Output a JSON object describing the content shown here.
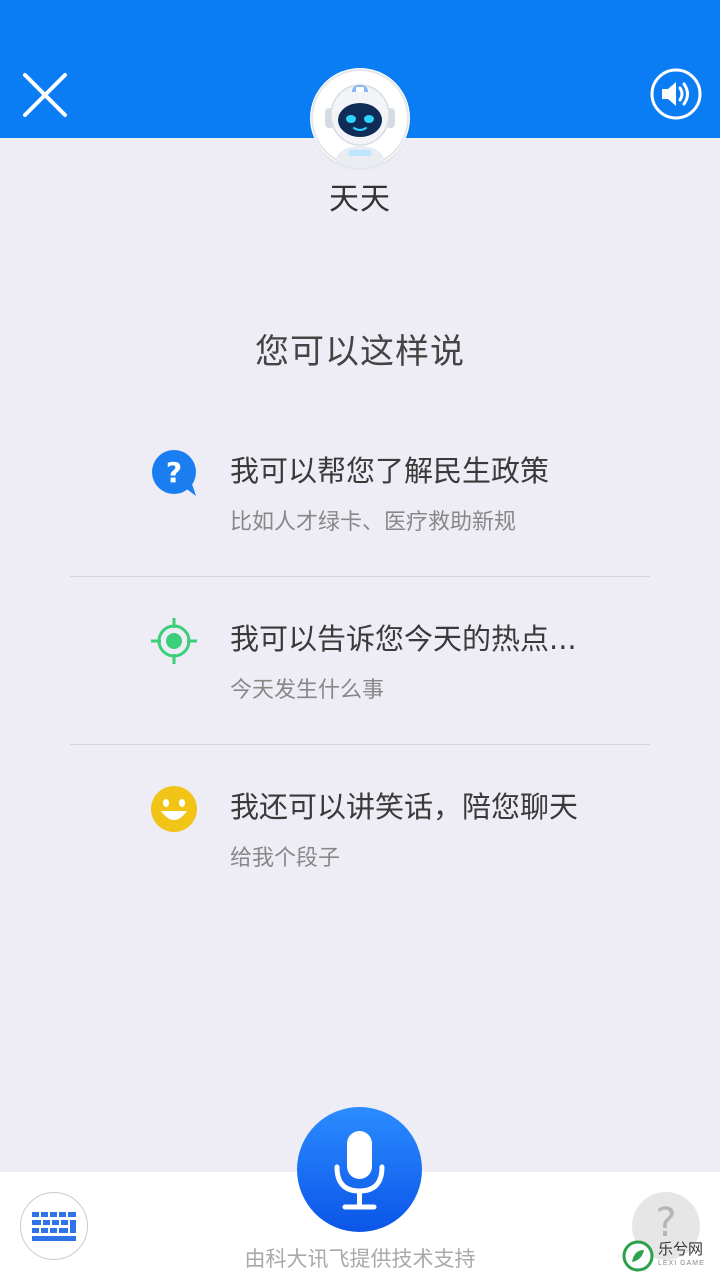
{
  "header": {
    "bot_name": "天天",
    "accent_color": "#0a7df5",
    "close_icon": "close-icon",
    "sound_icon": "speaker-icon",
    "avatar_icon": "robot-avatar-icon"
  },
  "main": {
    "prompt_title": "您可以这样说",
    "suggestions": [
      {
        "icon": "question-bubble-icon",
        "icon_color": "#1a7ef0",
        "title": "我可以帮您了解民生政策",
        "example": "比如人才绿卡、医疗救助新规"
      },
      {
        "icon": "target-icon",
        "icon_color": "#3ccf7a",
        "title": "我可以告诉您今天的热点...",
        "example": "今天发生什么事"
      },
      {
        "icon": "smiley-icon",
        "icon_color": "#f2c417",
        "title": "我还可以讲笑话，陪您聊天",
        "example": "给我个段子"
      }
    ]
  },
  "footer": {
    "keyboard_icon": "keyboard-icon",
    "mic_icon": "microphone-icon",
    "help_icon": "help-icon",
    "help_glyph": "?",
    "powered_by": "由科大讯飞提供技术支持",
    "watermark_text": "乐兮网",
    "watermark_sub": "LEXI GAME"
  }
}
